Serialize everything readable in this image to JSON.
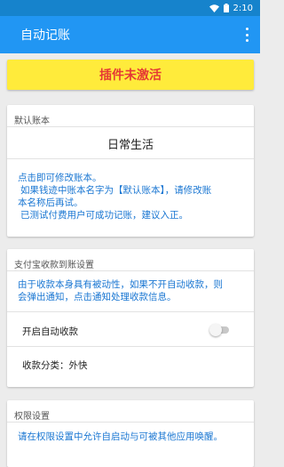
{
  "status_bar": {
    "time": "2:10",
    "wifi_icon": "wifi-icon",
    "battery_icon": "battery-icon"
  },
  "app_bar": {
    "title": "自动记账",
    "menu_icon": "more-vert-icon"
  },
  "banner": {
    "text": "插件未激活",
    "bg_color": "#ffeb3b",
    "text_color": "#e53935"
  },
  "default_book": {
    "title": "默认账本",
    "book_name": "日常生活",
    "hint_lines": [
      "点击即可修改账本。",
      "如果钱迹中账本名字为【默认账本】，请修改账",
      "本名称后再试。",
      "已测试付费用户可成功记账，建议入正。"
    ]
  },
  "alipay": {
    "title": "支付宝收款到账设置",
    "hint_lines": [
      "由于收款本身具有被动性，如果不开自动收款，则",
      "会弹出通知，点击通知处理收款信息。"
    ],
    "auto_receive_label": "开启自动收款",
    "auto_receive_on": false,
    "category_label": "收款分类：外快"
  },
  "permissions": {
    "title": "权限设置",
    "hint_lines": [
      "请在权限设置中允许自启动与可被其他应用唤醒。"
    ]
  },
  "accent_color": "#2196f3",
  "hint_color": "#1976d2"
}
